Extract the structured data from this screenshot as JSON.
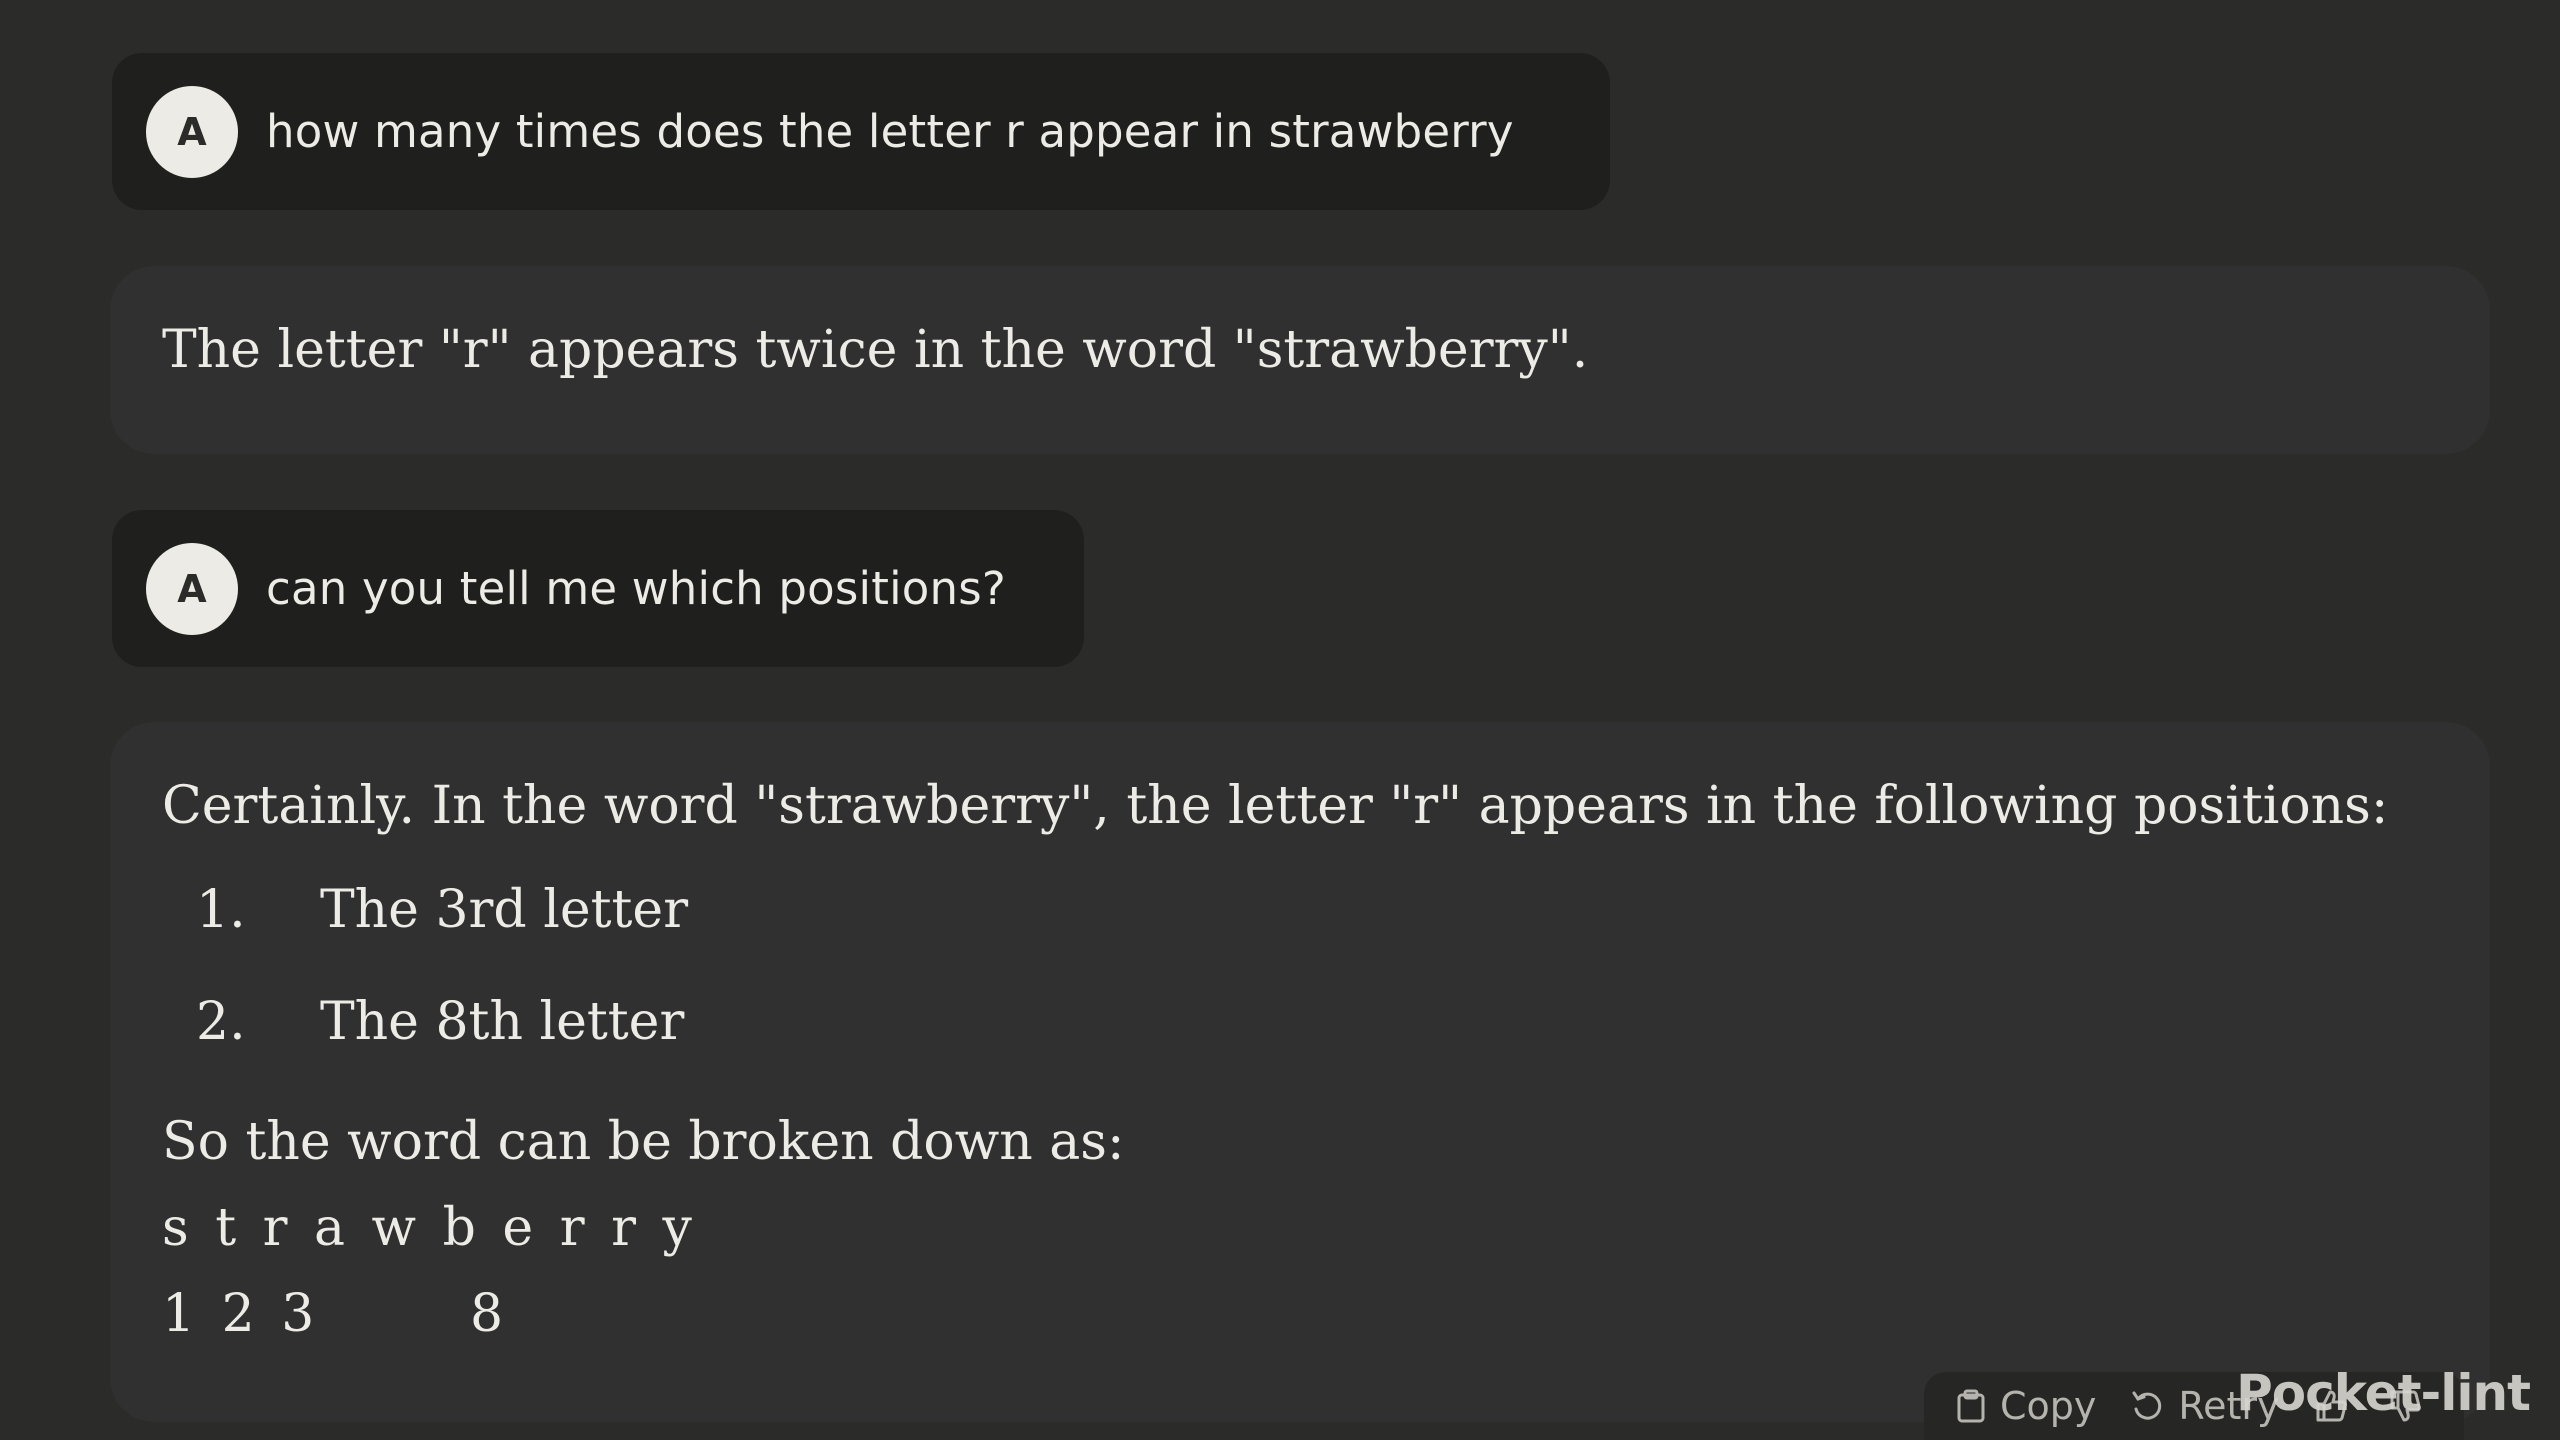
{
  "conversation": {
    "messages": [
      {
        "role": "user",
        "avatar_initial": "A",
        "text": "how many times does the letter r appear in strawberry"
      },
      {
        "role": "assistant",
        "text": "The letter \"r\" appears twice in the word \"strawberry\"."
      },
      {
        "role": "user",
        "avatar_initial": "A",
        "text": "can you tell me which positions?"
      },
      {
        "role": "assistant",
        "intro": "Certainly. In the word \"strawberry\", the letter \"r\" appears in the following positions:",
        "list": [
          {
            "number": "1.",
            "text": "The 3rd letter"
          },
          {
            "number": "2.",
            "text": "The 8th letter"
          }
        ],
        "breakdown_label": "So the word can be broken down as:",
        "letters": "s t r a w b e r r y",
        "positions": "1 2 3       8"
      }
    ]
  },
  "actions": {
    "copy_label": "Copy",
    "retry_label": "Retry",
    "icons": [
      "copy-icon",
      "retry-icon",
      "thumbs-up-icon",
      "thumbs-down-icon"
    ]
  },
  "watermark": {
    "text": "Pocket-lint"
  },
  "colors": {
    "background": "#2b2b29",
    "user_bubble": "#1f1f1d",
    "assistant_bubble": "#303030",
    "text": "#ecebe6",
    "avatar_bg": "#ecebe6"
  }
}
